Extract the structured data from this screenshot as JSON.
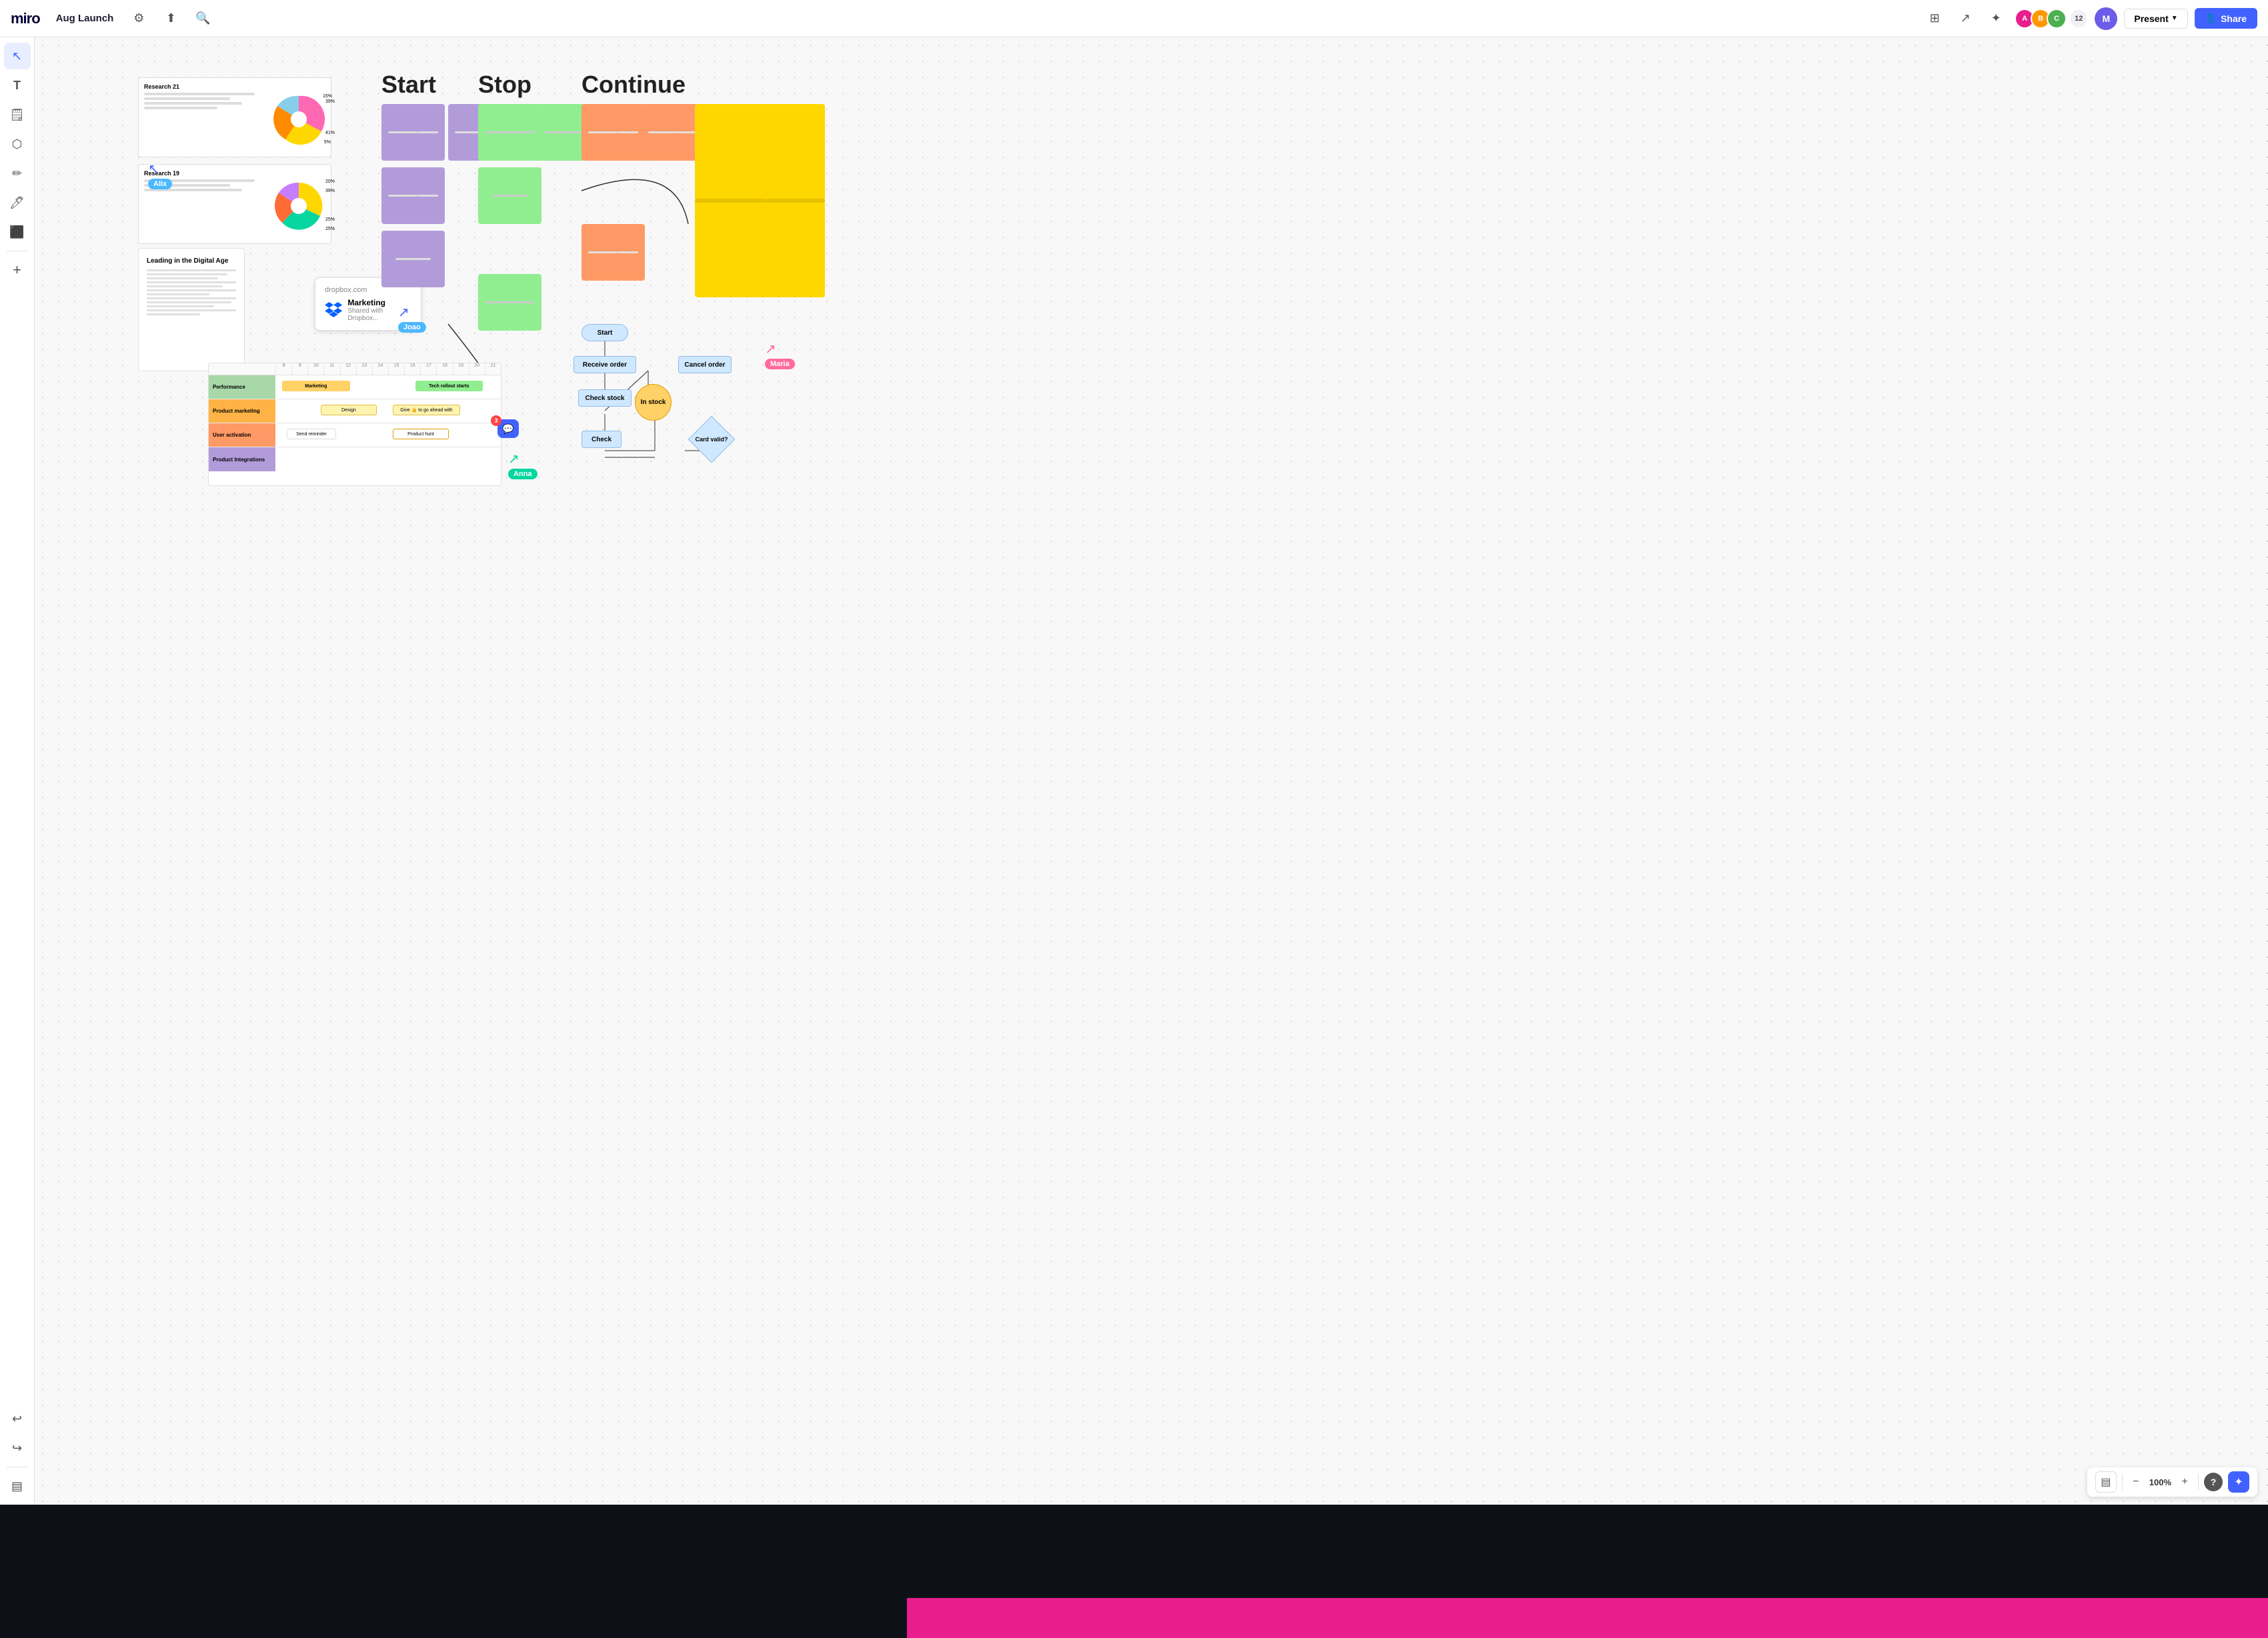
{
  "app": {
    "logo": "miro",
    "board_title": "Aug Launch",
    "settings_icon": "⚙",
    "export_icon": "↑",
    "search_icon": "🔍"
  },
  "topbar_right": {
    "grid_icon": "⊞",
    "cursor_icon": "↖",
    "magic_icon": "✦",
    "avatar_count": "12",
    "present_label": "Present",
    "share_label": "Share",
    "share_icon": "👤"
  },
  "toolbar": {
    "tools": [
      {
        "name": "select",
        "icon": "↖",
        "active": true
      },
      {
        "name": "text",
        "icon": "T"
      },
      {
        "name": "sticky",
        "icon": "□"
      },
      {
        "name": "shapes",
        "icon": "⬡"
      },
      {
        "name": "pen",
        "icon": "/"
      },
      {
        "name": "marker",
        "icon": "🖊"
      },
      {
        "name": "frame",
        "icon": "⬛"
      },
      {
        "name": "plus",
        "icon": "+"
      }
    ],
    "undo": "↩",
    "redo": "↪",
    "panel": "▤"
  },
  "canvas": {
    "retro": {
      "start_label": "Start",
      "stop_label": "Stop",
      "continue_label": "Continue"
    },
    "cursors": [
      {
        "name": "Alix",
        "color": "#4cb8ff"
      },
      {
        "name": "Joao",
        "color": "#4cb8ff"
      },
      {
        "name": "Anna",
        "color": "#06d6a0"
      },
      {
        "name": "Maria",
        "color": "#ff6b9d"
      }
    ],
    "documents": [
      {
        "title": "Research 21"
      },
      {
        "title": "Research 19"
      },
      {
        "title": "Leading in the Digital Age"
      }
    ],
    "dropbox": {
      "domain": "dropbox.com",
      "filename": "Marketing",
      "subtitle": "Shared with Dropbox..."
    },
    "gantt": {
      "rows": [
        "Performance",
        "Product marketing",
        "User activation",
        "Product integrations"
      ],
      "items": [
        "Marketing",
        "Tech rollout starts",
        "Design",
        "Give 👍 to go ahead with",
        "Send reminder",
        "Product hunt"
      ]
    },
    "flowchart": {
      "nodes": [
        "Start",
        "Receive order",
        "Check stock",
        "In stock",
        "Cancel order",
        "Check",
        "Card valid?"
      ]
    }
  },
  "zoom": {
    "minus_label": "−",
    "level": "100%",
    "plus_label": "+"
  }
}
